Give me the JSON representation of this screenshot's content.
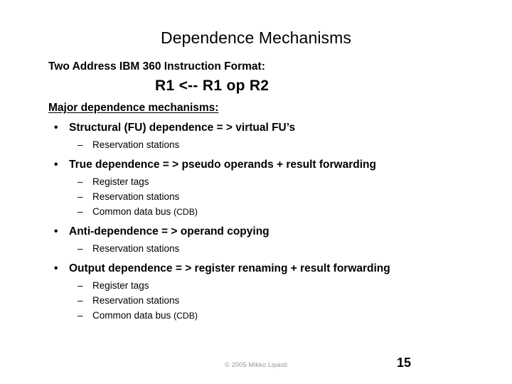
{
  "slide": {
    "title": "Dependence Mechanisms",
    "format_heading": "Two Address IBM 360 Instruction Format:",
    "formula": "R1 <-- R1  op  R2",
    "section_heading": "Major dependence mechanisms:",
    "bullet_marker": "•",
    "sub_bullet_marker": "–",
    "bullets": [
      {
        "text": "Structural (FU) dependence = > virtual FU’s",
        "subs": [
          {
            "text": "Reservation stations",
            "paren": ""
          }
        ]
      },
      {
        "text": "True dependence = > pseudo operands + result forwarding",
        "subs": [
          {
            "text": "Register tags",
            "paren": ""
          },
          {
            "text": "Reservation stations",
            "paren": ""
          },
          {
            "text": "Common data bus ",
            "paren": "(CDB)"
          }
        ]
      },
      {
        "text": "Anti-dependence = > operand copying",
        "subs": [
          {
            "text": "Reservation stations",
            "paren": ""
          }
        ]
      },
      {
        "text": "Output dependence = > register renaming + result forwarding",
        "subs": [
          {
            "text": "Register tags",
            "paren": ""
          },
          {
            "text": "Reservation stations",
            "paren": ""
          },
          {
            "text": "Common data bus ",
            "paren": "(CDB)"
          }
        ]
      }
    ],
    "footer": {
      "credit": "© 2005 Mikko Lipasti",
      "page_number": "15"
    },
    "colors": {
      "background": "#ffffff",
      "text": "#000000",
      "credit_gray": "#9b9b9b"
    }
  }
}
